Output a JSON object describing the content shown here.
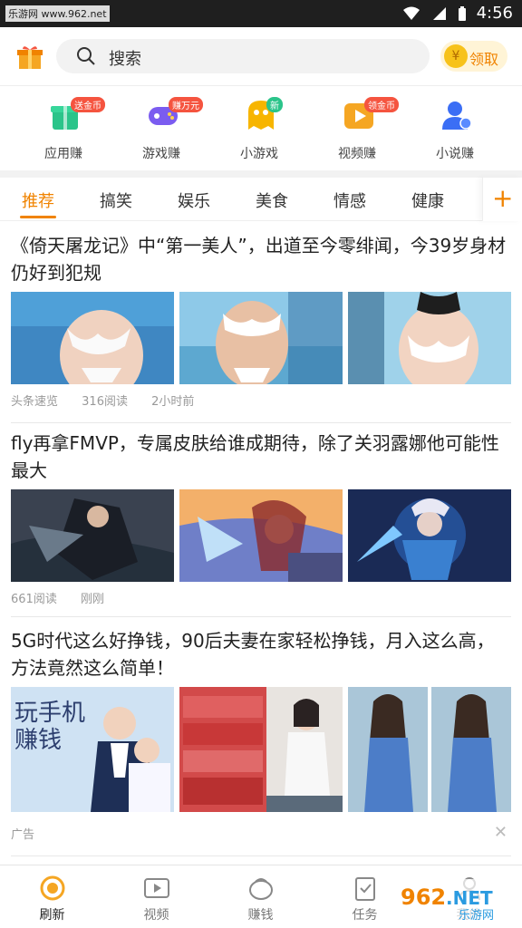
{
  "status_bar": {
    "watermark": "乐游网 www.962.net",
    "time": "4:56"
  },
  "header": {
    "search_placeholder": "搜索",
    "claim_label": "领取",
    "coin_symbol": "¥"
  },
  "earn_items": [
    {
      "label": "应用赚",
      "tag": "送金币",
      "icon": "app-gift-icon"
    },
    {
      "label": "游戏赚",
      "tag": "赚万元",
      "icon": "gamepad-icon"
    },
    {
      "label": "小游戏",
      "tag": "新",
      "icon": "mini-game-icon"
    },
    {
      "label": "视频赚",
      "tag": "领金币",
      "icon": "video-play-icon"
    },
    {
      "label": "小说赚",
      "tag": "",
      "icon": "reader-icon"
    }
  ],
  "tabs": [
    "推荐",
    "搞笑",
    "娱乐",
    "美食",
    "情感",
    "健康"
  ],
  "articles": [
    {
      "title": "《倚天屠龙记》中“第一美人”，出道至今零绯闻，今39岁身材仍好到犯规",
      "source": "头条速览",
      "reads": "316阅读",
      "time": "2小时前"
    },
    {
      "title": "fly再拿FMVP，专属皮肤给谁成期待，除了关羽露娜他可能性最大",
      "source": "",
      "reads": "661阅读",
      "time": "刚刚"
    },
    {
      "title": "5G时代这么好挣钱，90后夫妻在家轻松挣钱，月入这么高，方法竟然这么简单！",
      "source": "广告",
      "reads": "",
      "time": ""
    }
  ],
  "ad_image_text": "玩手机赚钱",
  "bottom_nav": [
    {
      "label": "刷新",
      "icon": "refresh-icon"
    },
    {
      "label": "视频",
      "icon": "video-icon"
    },
    {
      "label": "赚钱",
      "icon": "earn-icon"
    },
    {
      "label": "任务",
      "icon": "task-icon"
    },
    {
      "label": "我的",
      "icon": "profile-icon"
    }
  ],
  "watermark_logo": "962.NET 乐游网",
  "colors": {
    "accent": "#f08300",
    "tag_red": "#f5543f"
  }
}
